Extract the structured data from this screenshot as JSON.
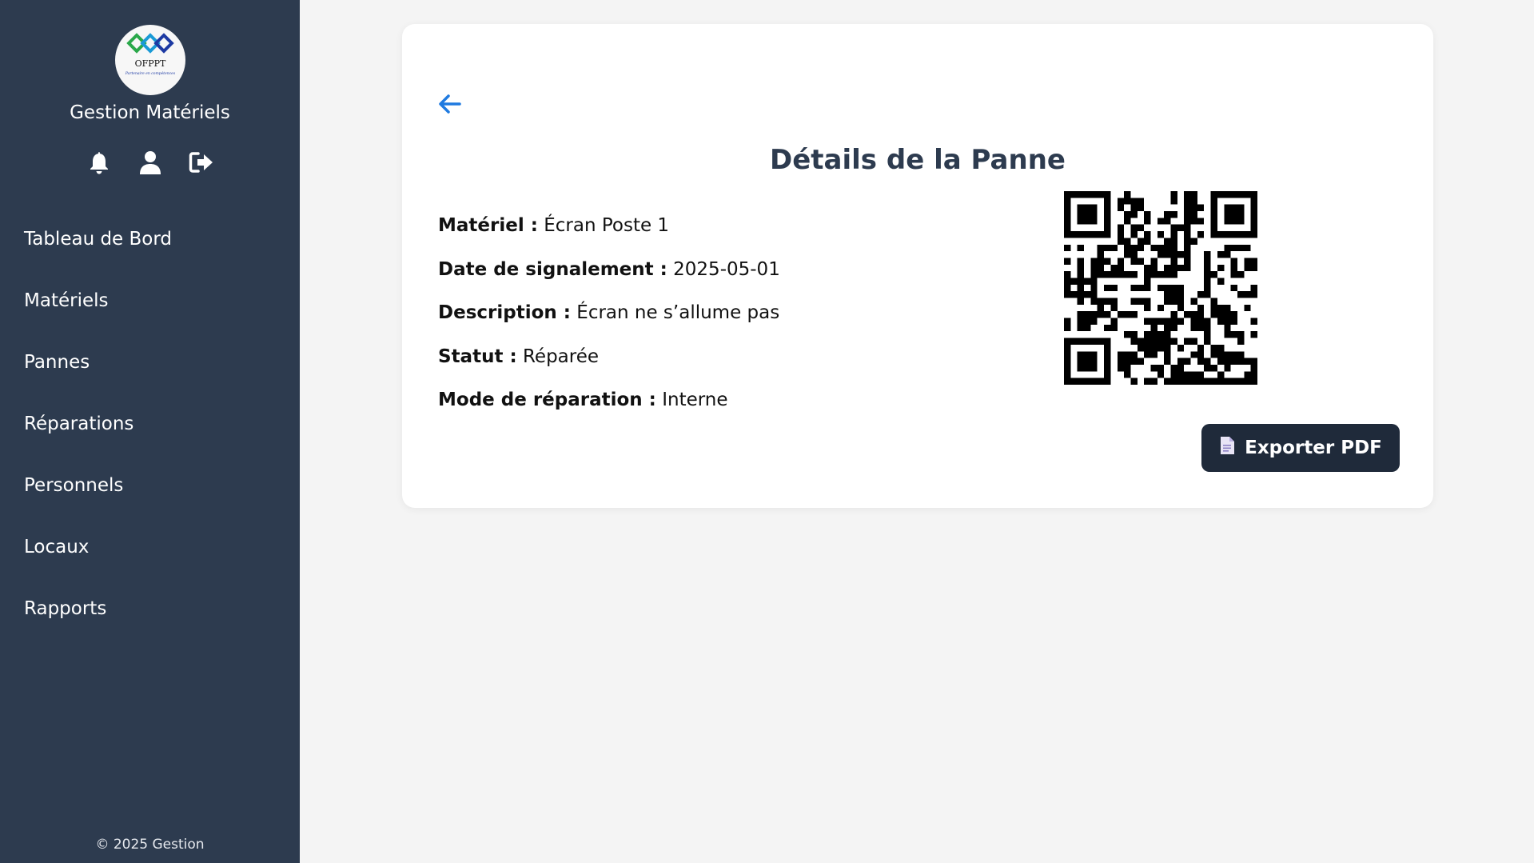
{
  "app": {
    "title": "Gestion Matériels",
    "logo_text": "OFPPT",
    "logo_tagline": "Partenaire en compétences",
    "footer": "© 2025 Gestion"
  },
  "header_icons": [
    "bell-icon",
    "user-icon",
    "logout-icon"
  ],
  "nav": [
    {
      "label": "Tableau de Bord"
    },
    {
      "label": "Matériels"
    },
    {
      "label": "Pannes"
    },
    {
      "label": "Réparations"
    },
    {
      "label": "Personnels"
    },
    {
      "label": "Locaux"
    },
    {
      "label": "Rapports"
    }
  ],
  "panne": {
    "title": "Détails de la Panne",
    "fields": [
      {
        "label": "Matériel :",
        "value": "Écran Poste 1"
      },
      {
        "label": "Date de signalement :",
        "value": "2025-05-01"
      },
      {
        "label": "Description :",
        "value": "Écran ne s’allume pas"
      },
      {
        "label": "Statut :",
        "value": "Réparée"
      },
      {
        "label": "Mode de réparation :",
        "value": "Interne"
      }
    ],
    "export_label": "Exporter PDF"
  },
  "colors": {
    "sidebar": "#2d3b4f",
    "accent": "#1f7ae0",
    "title": "#2d3b4f",
    "button": "#1f2a3a",
    "background": "#f4f4f4"
  }
}
